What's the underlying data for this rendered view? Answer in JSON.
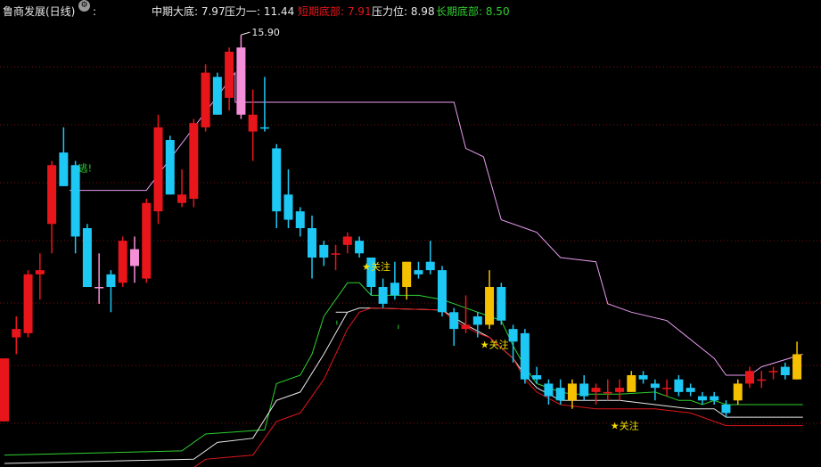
{
  "title": "鲁商发展(日线)",
  "colors": {
    "up": "#e8161b",
    "down": "#1ec8f5",
    "pink": "#f58fd8",
    "yellow": "#f5c000",
    "mid_line": "#e89bf0",
    "line_green": "#2fd02f",
    "line_white": "#e8e8e8",
    "line_red": "#e0161b",
    "grid": "#7a0e0e"
  },
  "legend": [
    {
      "label": "中期大底: 7.97",
      "color": "#e8e8e8"
    },
    {
      "label": "压力一: 11.44",
      "color": "#e8e8e8"
    },
    {
      "label": "短期底部: 7.91",
      "color": "#e8161b"
    },
    {
      "label": "压力位: 8.98",
      "color": "#e8e8e8"
    },
    {
      "label": "长期底部: 8.50",
      "color": "#2fd02f"
    }
  ],
  "chart_data": {
    "type": "candlestick",
    "ylim": [
      6.0,
      16.5
    ],
    "high_annotation": {
      "text": "15.90",
      "index": 20
    },
    "annotations": [
      {
        "text": "逃!",
        "index": 6,
        "value": 12.95,
        "color": "#2fd02f"
      },
      {
        "text": "★关注",
        "index": 30,
        "value": 10.6,
        "color": "#f5e000"
      },
      {
        "text": "★关注",
        "index": 40,
        "value": 8.75,
        "color": "#f5e000"
      },
      {
        "text": "★关注",
        "index": 51,
        "value": 6.82,
        "color": "#f5e000"
      }
    ],
    "candles": [
      {
        "o": 7.0,
        "h": 8.5,
        "l": 7.0,
        "c": 8.5,
        "type": "up"
      },
      {
        "o": 9.0,
        "h": 9.5,
        "l": 8.6,
        "c": 9.2,
        "type": "up"
      },
      {
        "o": 9.1,
        "h": 10.6,
        "l": 9.0,
        "c": 10.5,
        "type": "up"
      },
      {
        "o": 10.6,
        "h": 11.0,
        "l": 9.9,
        "c": 10.5,
        "type": "up"
      },
      {
        "o": 11.7,
        "h": 13.2,
        "l": 11.0,
        "c": 13.1,
        "type": "up"
      },
      {
        "o": 13.4,
        "h": 14.0,
        "l": 12.6,
        "c": 12.6,
        "type": "down"
      },
      {
        "o": 13.1,
        "h": 13.2,
        "l": 11.0,
        "c": 11.4,
        "type": "down"
      },
      {
        "o": 11.6,
        "h": 11.7,
        "l": 10.2,
        "c": 10.2,
        "type": "down"
      },
      {
        "o": 10.2,
        "h": 11.0,
        "l": 9.8,
        "c": 10.2,
        "type": "pink"
      },
      {
        "o": 10.5,
        "h": 10.6,
        "l": 9.6,
        "c": 10.2,
        "type": "down"
      },
      {
        "o": 10.3,
        "h": 11.4,
        "l": 10.2,
        "c": 11.3,
        "type": "up"
      },
      {
        "o": 10.7,
        "h": 11.4,
        "l": 10.3,
        "c": 11.1,
        "type": "pink"
      },
      {
        "o": 10.4,
        "h": 12.3,
        "l": 10.3,
        "c": 12.2,
        "type": "up"
      },
      {
        "o": 12.0,
        "h": 14.3,
        "l": 11.7,
        "c": 14.0,
        "type": "up"
      },
      {
        "o": 13.7,
        "h": 13.8,
        "l": 12.4,
        "c": 12.4,
        "type": "down"
      },
      {
        "o": 12.4,
        "h": 13.0,
        "l": 12.1,
        "c": 12.2,
        "type": "up"
      },
      {
        "o": 12.3,
        "h": 14.2,
        "l": 12.1,
        "c": 14.1,
        "type": "up"
      },
      {
        "o": 14.0,
        "h": 15.5,
        "l": 13.9,
        "c": 15.3,
        "type": "up"
      },
      {
        "o": 15.2,
        "h": 15.3,
        "l": 14.3,
        "c": 14.3,
        "type": "down"
      },
      {
        "o": 14.7,
        "h": 15.9,
        "l": 14.4,
        "c": 15.8,
        "type": "up"
      },
      {
        "o": 15.9,
        "h": 16.2,
        "l": 14.2,
        "c": 14.3,
        "type": "pink"
      },
      {
        "o": 14.3,
        "h": 14.9,
        "l": 13.2,
        "c": 13.9,
        "type": "up"
      },
      {
        "o": 14.0,
        "h": 15.2,
        "l": 13.9,
        "c": 14.0,
        "type": "down"
      },
      {
        "o": 13.5,
        "h": 13.6,
        "l": 11.6,
        "c": 12.0,
        "type": "down"
      },
      {
        "o": 12.4,
        "h": 13.0,
        "l": 11.6,
        "c": 11.8,
        "type": "down"
      },
      {
        "o": 12.0,
        "h": 12.1,
        "l": 11.4,
        "c": 11.6,
        "type": "down"
      },
      {
        "o": 11.6,
        "h": 11.9,
        "l": 10.4,
        "c": 10.9,
        "type": "down"
      },
      {
        "o": 11.2,
        "h": 11.3,
        "l": 10.7,
        "c": 10.9,
        "type": "down"
      },
      {
        "o": 11.0,
        "h": 11.2,
        "l": 10.6,
        "c": 11.0,
        "type": "up"
      },
      {
        "o": 11.2,
        "h": 11.5,
        "l": 11.0,
        "c": 11.4,
        "type": "up"
      },
      {
        "o": 11.3,
        "h": 11.4,
        "l": 10.9,
        "c": 11.0,
        "type": "down"
      },
      {
        "o": 10.9,
        "h": 10.9,
        "l": 10.0,
        "c": 10.2,
        "type": "down"
      },
      {
        "o": 10.2,
        "h": 10.4,
        "l": 9.7,
        "c": 9.8,
        "type": "down"
      },
      {
        "o": 10.0,
        "h": 10.8,
        "l": 9.9,
        "c": 10.3,
        "type": "down"
      },
      {
        "o": 10.2,
        "h": 10.8,
        "l": 9.9,
        "c": 10.8,
        "type": "yellow"
      },
      {
        "o": 10.6,
        "h": 10.8,
        "l": 10.4,
        "c": 10.5,
        "type": "down"
      },
      {
        "o": 10.8,
        "h": 11.3,
        "l": 10.5,
        "c": 10.6,
        "type": "down"
      },
      {
        "o": 10.6,
        "h": 10.7,
        "l": 9.5,
        "c": 9.6,
        "type": "down"
      },
      {
        "o": 9.6,
        "h": 9.7,
        "l": 8.8,
        "c": 9.2,
        "type": "down"
      },
      {
        "o": 9.2,
        "h": 10.0,
        "l": 9.1,
        "c": 9.3,
        "type": "up"
      },
      {
        "o": 9.5,
        "h": 9.6,
        "l": 9.0,
        "c": 9.3,
        "type": "down"
      },
      {
        "o": 9.3,
        "h": 10.6,
        "l": 9.2,
        "c": 10.2,
        "type": "yellow"
      },
      {
        "o": 10.2,
        "h": 10.3,
        "l": 9.3,
        "c": 9.4,
        "type": "down"
      },
      {
        "o": 9.2,
        "h": 9.3,
        "l": 8.4,
        "c": 8.9,
        "type": "down"
      },
      {
        "o": 9.1,
        "h": 9.2,
        "l": 7.9,
        "c": 8.0,
        "type": "down"
      },
      {
        "o": 8.1,
        "h": 8.3,
        "l": 7.9,
        "c": 8.0,
        "type": "down"
      },
      {
        "o": 7.9,
        "h": 8.0,
        "l": 7.4,
        "c": 7.6,
        "type": "down"
      },
      {
        "o": 7.8,
        "h": 8.0,
        "l": 7.4,
        "c": 7.5,
        "type": "down"
      },
      {
        "o": 7.5,
        "h": 8.0,
        "l": 7.3,
        "c": 7.9,
        "type": "yellow"
      },
      {
        "o": 7.9,
        "h": 8.1,
        "l": 7.5,
        "c": 7.6,
        "type": "down"
      },
      {
        "o": 7.8,
        "h": 7.9,
        "l": 7.4,
        "c": 7.7,
        "type": "up"
      },
      {
        "o": 7.7,
        "h": 8.0,
        "l": 7.5,
        "c": 7.7,
        "type": "up"
      },
      {
        "o": 7.8,
        "h": 8.0,
        "l": 7.5,
        "c": 7.7,
        "type": "up"
      },
      {
        "o": 7.7,
        "h": 8.2,
        "l": 7.7,
        "c": 8.1,
        "type": "yellow"
      },
      {
        "o": 8.0,
        "h": 8.2,
        "l": 7.9,
        "c": 8.1,
        "type": "down"
      },
      {
        "o": 7.9,
        "h": 8.0,
        "l": 7.5,
        "c": 7.8,
        "type": "down"
      },
      {
        "o": 7.8,
        "h": 8.0,
        "l": 7.6,
        "c": 7.8,
        "type": "up"
      },
      {
        "o": 8.0,
        "h": 8.1,
        "l": 7.6,
        "c": 7.7,
        "type": "down"
      },
      {
        "o": 7.8,
        "h": 7.9,
        "l": 7.6,
        "c": 7.7,
        "type": "down"
      },
      {
        "o": 7.6,
        "h": 7.7,
        "l": 7.4,
        "c": 7.5,
        "type": "down"
      },
      {
        "o": 7.6,
        "h": 7.7,
        "l": 7.4,
        "c": 7.5,
        "type": "down"
      },
      {
        "o": 7.4,
        "h": 7.5,
        "l": 7.1,
        "c": 7.2,
        "type": "down"
      },
      {
        "o": 7.5,
        "h": 8.0,
        "l": 7.4,
        "c": 7.9,
        "type": "yellow"
      },
      {
        "o": 7.9,
        "h": 8.3,
        "l": 7.8,
        "c": 8.2,
        "type": "up"
      },
      {
        "o": 8.0,
        "h": 8.2,
        "l": 7.8,
        "c": 8.0,
        "type": "up"
      },
      {
        "o": 8.2,
        "h": 8.3,
        "l": 8.0,
        "c": 8.2,
        "type": "up"
      },
      {
        "o": 8.3,
        "h": 8.4,
        "l": 8.0,
        "c": 8.1,
        "type": "down"
      },
      {
        "o": 8.0,
        "h": 8.9,
        "l": 8.0,
        "c": 8.6,
        "type": "yellow"
      }
    ],
    "lines": [
      {
        "key": "mid_line",
        "values": [
          [
            5.5,
            12.5
          ],
          [
            12,
            12.5
          ],
          [
            19.5,
            15.3
          ],
          [
            19.5,
            14.6
          ],
          [
            38,
            14.6
          ],
          [
            39,
            13.5
          ],
          [
            40.5,
            13.3
          ],
          [
            42,
            11.8
          ],
          [
            44,
            11.6
          ],
          [
            45,
            11.5
          ],
          [
            47,
            10.9
          ],
          [
            50,
            10.8
          ],
          [
            51,
            9.8
          ],
          [
            53,
            9.6
          ],
          [
            56,
            9.4
          ],
          [
            60,
            8.5
          ],
          [
            61,
            8.1
          ],
          [
            63,
            8.1
          ],
          [
            64,
            8.3
          ],
          [
            67.5,
            8.6
          ]
        ]
      },
      {
        "key": "line_green",
        "values": [
          [
            0,
            6.2
          ],
          [
            15,
            6.3
          ],
          [
            17,
            6.7
          ],
          [
            22,
            6.8
          ],
          [
            23,
            7.9
          ],
          [
            25,
            8.1
          ],
          [
            26,
            8.6
          ],
          [
            27,
            9.5
          ],
          [
            29,
            10.3
          ],
          [
            30,
            10.3
          ],
          [
            31,
            10.0
          ],
          [
            33,
            10.0
          ],
          [
            35,
            10.0
          ],
          [
            37,
            9.9
          ],
          [
            41,
            9.5
          ],
          [
            42,
            9.4
          ],
          [
            43,
            8.8
          ],
          [
            44,
            8.3
          ],
          [
            45,
            7.9
          ],
          [
            47,
            7.7
          ],
          [
            48,
            7.65
          ],
          [
            50,
            7.65
          ],
          [
            52,
            7.65
          ],
          [
            55,
            7.7
          ],
          [
            57,
            7.5
          ],
          [
            58,
            7.5
          ],
          [
            59,
            7.4
          ],
          [
            60,
            7.5
          ],
          [
            61,
            7.4
          ],
          [
            67.5,
            7.4
          ]
        ]
      },
      {
        "key": "line_white",
        "values": [
          [
            0,
            6.0
          ],
          [
            16,
            6.1
          ],
          [
            18,
            6.5
          ],
          [
            21,
            6.6
          ],
          [
            23,
            7.5
          ],
          [
            25,
            7.7
          ],
          [
            27,
            8.6
          ],
          [
            29,
            9.6
          ],
          [
            30,
            9.7
          ],
          [
            31,
            9.7
          ],
          [
            37,
            9.65
          ],
          [
            39,
            9.3
          ],
          [
            41,
            9.0
          ],
          [
            43,
            8.5
          ],
          [
            44,
            8.1
          ],
          [
            45,
            7.8
          ],
          [
            47,
            7.5
          ],
          [
            50,
            7.5
          ],
          [
            52,
            7.5
          ],
          [
            55,
            7.4
          ],
          [
            58,
            7.3
          ],
          [
            60,
            7.3
          ],
          [
            61,
            7.1
          ],
          [
            67.5,
            7.1
          ]
        ]
      },
      {
        "key": "line_red",
        "values": [
          [
            0,
            5.9
          ],
          [
            16,
            5.9
          ],
          [
            17,
            6.1
          ],
          [
            21,
            6.2
          ],
          [
            23,
            7.0
          ],
          [
            25,
            7.2
          ],
          [
            27,
            8.0
          ],
          [
            29,
            9.2
          ],
          [
            30,
            9.6
          ],
          [
            31,
            9.7
          ],
          [
            37,
            9.65
          ],
          [
            38,
            9.4
          ],
          [
            40,
            9.1
          ],
          [
            41,
            9.0
          ],
          [
            43,
            8.5
          ],
          [
            44,
            8.0
          ],
          [
            45,
            7.7
          ],
          [
            47,
            7.4
          ],
          [
            50,
            7.3
          ],
          [
            55,
            7.3
          ],
          [
            58,
            7.2
          ],
          [
            59,
            7.1
          ],
          [
            60,
            7.0
          ],
          [
            61,
            6.9
          ],
          [
            67.5,
            6.9
          ]
        ]
      }
    ],
    "fragments": [
      {
        "key": "line_white",
        "values": [
          [
            28,
            9.6
          ],
          [
            29,
            9.6
          ]
        ]
      },
      {
        "key": "line_green",
        "values": [
          [
            33.3,
            9.3
          ],
          [
            33.3,
            9.2
          ]
        ]
      },
      {
        "key": "line_green",
        "values": [
          [
            28.1,
            9.4
          ],
          [
            28.1,
            9.3
          ]
        ]
      }
    ]
  }
}
